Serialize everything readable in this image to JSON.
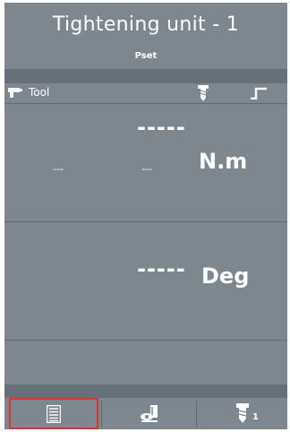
{
  "header": {
    "title": "Tightening unit - 1",
    "subtitle": "Pset"
  },
  "toolbar": {
    "tool_label": "Tool",
    "tool_icon": "tool-gun-icon",
    "screw_icon": "screw-icon",
    "step_icon": "step-icon"
  },
  "torque": {
    "value": "-----",
    "left_small": "---",
    "mid_small": "---",
    "unit": "N.m"
  },
  "angle": {
    "value": "-----",
    "unit": "Deg"
  },
  "bottom_nav": {
    "items": [
      {
        "icon": "list-icon",
        "selected": true
      },
      {
        "icon": "inspect-icon",
        "selected": false
      },
      {
        "icon": "screw-count-icon",
        "count": "1",
        "selected": false
      }
    ]
  },
  "colors": {
    "background": "#7c8790",
    "separator": "#65707a",
    "selected_outline": "#e03232",
    "text": "#ffffff"
  }
}
